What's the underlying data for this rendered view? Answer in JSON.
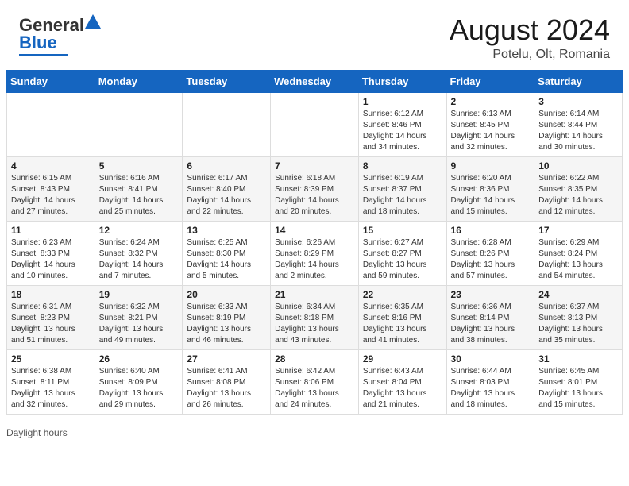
{
  "header": {
    "logo_general": "General",
    "logo_blue": "Blue",
    "month_year": "August 2024",
    "location": "Potelu, Olt, Romania"
  },
  "days_of_week": [
    "Sunday",
    "Monday",
    "Tuesday",
    "Wednesday",
    "Thursday",
    "Friday",
    "Saturday"
  ],
  "weeks": [
    [
      {
        "day": "",
        "info": ""
      },
      {
        "day": "",
        "info": ""
      },
      {
        "day": "",
        "info": ""
      },
      {
        "day": "",
        "info": ""
      },
      {
        "day": "1",
        "info": "Sunrise: 6:12 AM\nSunset: 8:46 PM\nDaylight: 14 hours and 34 minutes."
      },
      {
        "day": "2",
        "info": "Sunrise: 6:13 AM\nSunset: 8:45 PM\nDaylight: 14 hours and 32 minutes."
      },
      {
        "day": "3",
        "info": "Sunrise: 6:14 AM\nSunset: 8:44 PM\nDaylight: 14 hours and 30 minutes."
      }
    ],
    [
      {
        "day": "4",
        "info": "Sunrise: 6:15 AM\nSunset: 8:43 PM\nDaylight: 14 hours and 27 minutes."
      },
      {
        "day": "5",
        "info": "Sunrise: 6:16 AM\nSunset: 8:41 PM\nDaylight: 14 hours and 25 minutes."
      },
      {
        "day": "6",
        "info": "Sunrise: 6:17 AM\nSunset: 8:40 PM\nDaylight: 14 hours and 22 minutes."
      },
      {
        "day": "7",
        "info": "Sunrise: 6:18 AM\nSunset: 8:39 PM\nDaylight: 14 hours and 20 minutes."
      },
      {
        "day": "8",
        "info": "Sunrise: 6:19 AM\nSunset: 8:37 PM\nDaylight: 14 hours and 18 minutes."
      },
      {
        "day": "9",
        "info": "Sunrise: 6:20 AM\nSunset: 8:36 PM\nDaylight: 14 hours and 15 minutes."
      },
      {
        "day": "10",
        "info": "Sunrise: 6:22 AM\nSunset: 8:35 PM\nDaylight: 14 hours and 12 minutes."
      }
    ],
    [
      {
        "day": "11",
        "info": "Sunrise: 6:23 AM\nSunset: 8:33 PM\nDaylight: 14 hours and 10 minutes."
      },
      {
        "day": "12",
        "info": "Sunrise: 6:24 AM\nSunset: 8:32 PM\nDaylight: 14 hours and 7 minutes."
      },
      {
        "day": "13",
        "info": "Sunrise: 6:25 AM\nSunset: 8:30 PM\nDaylight: 14 hours and 5 minutes."
      },
      {
        "day": "14",
        "info": "Sunrise: 6:26 AM\nSunset: 8:29 PM\nDaylight: 14 hours and 2 minutes."
      },
      {
        "day": "15",
        "info": "Sunrise: 6:27 AM\nSunset: 8:27 PM\nDaylight: 13 hours and 59 minutes."
      },
      {
        "day": "16",
        "info": "Sunrise: 6:28 AM\nSunset: 8:26 PM\nDaylight: 13 hours and 57 minutes."
      },
      {
        "day": "17",
        "info": "Sunrise: 6:29 AM\nSunset: 8:24 PM\nDaylight: 13 hours and 54 minutes."
      }
    ],
    [
      {
        "day": "18",
        "info": "Sunrise: 6:31 AM\nSunset: 8:23 PM\nDaylight: 13 hours and 51 minutes."
      },
      {
        "day": "19",
        "info": "Sunrise: 6:32 AM\nSunset: 8:21 PM\nDaylight: 13 hours and 49 minutes."
      },
      {
        "day": "20",
        "info": "Sunrise: 6:33 AM\nSunset: 8:19 PM\nDaylight: 13 hours and 46 minutes."
      },
      {
        "day": "21",
        "info": "Sunrise: 6:34 AM\nSunset: 8:18 PM\nDaylight: 13 hours and 43 minutes."
      },
      {
        "day": "22",
        "info": "Sunrise: 6:35 AM\nSunset: 8:16 PM\nDaylight: 13 hours and 41 minutes."
      },
      {
        "day": "23",
        "info": "Sunrise: 6:36 AM\nSunset: 8:14 PM\nDaylight: 13 hours and 38 minutes."
      },
      {
        "day": "24",
        "info": "Sunrise: 6:37 AM\nSunset: 8:13 PM\nDaylight: 13 hours and 35 minutes."
      }
    ],
    [
      {
        "day": "25",
        "info": "Sunrise: 6:38 AM\nSunset: 8:11 PM\nDaylight: 13 hours and 32 minutes."
      },
      {
        "day": "26",
        "info": "Sunrise: 6:40 AM\nSunset: 8:09 PM\nDaylight: 13 hours and 29 minutes."
      },
      {
        "day": "27",
        "info": "Sunrise: 6:41 AM\nSunset: 8:08 PM\nDaylight: 13 hours and 26 minutes."
      },
      {
        "day": "28",
        "info": "Sunrise: 6:42 AM\nSunset: 8:06 PM\nDaylight: 13 hours and 24 minutes."
      },
      {
        "day": "29",
        "info": "Sunrise: 6:43 AM\nSunset: 8:04 PM\nDaylight: 13 hours and 21 minutes."
      },
      {
        "day": "30",
        "info": "Sunrise: 6:44 AM\nSunset: 8:03 PM\nDaylight: 13 hours and 18 minutes."
      },
      {
        "day": "31",
        "info": "Sunrise: 6:45 AM\nSunset: 8:01 PM\nDaylight: 13 hours and 15 minutes."
      }
    ]
  ],
  "footer": {
    "daylight_label": "Daylight hours"
  }
}
